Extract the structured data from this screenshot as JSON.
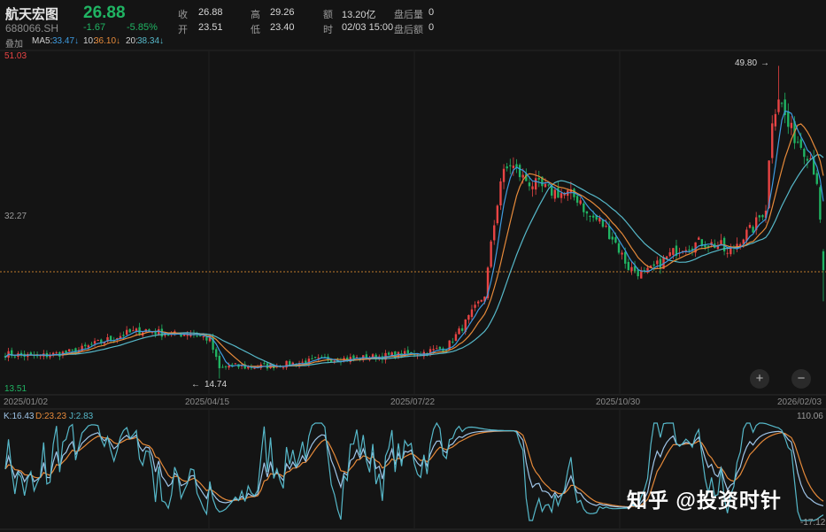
{
  "header": {
    "name": "航天宏图",
    "code": "688066.SH",
    "price": "26.88",
    "change": "-1.67",
    "change_pct": "-5.85%",
    "overlay_label": "叠加",
    "stats": [
      {
        "label": "收",
        "value": "26.88"
      },
      {
        "label": "开",
        "value": "23.51"
      },
      {
        "label": "高",
        "value": "29.26"
      },
      {
        "label": "低",
        "value": "23.40"
      },
      {
        "label": "额",
        "value": "13.20亿"
      },
      {
        "label": "时",
        "value": "02/03 15:00"
      },
      {
        "label": "盘后量",
        "value": "0"
      },
      {
        "label": "盘后额",
        "value": "0"
      }
    ],
    "ma": [
      {
        "label": "MA5:",
        "value": "33.47↓",
        "color": "#3d9be0"
      },
      {
        "label": "10:",
        "value": "36.10↓",
        "color": "#e68a3a"
      },
      {
        "label": "20:",
        "value": "38.34↓",
        "color": "#56b8c9"
      }
    ]
  },
  "price_axis": {
    "top": "51.03",
    "mid": "32.27",
    "bottom": "13.51"
  },
  "annotations": {
    "high": "49.80",
    "low": "14.74"
  },
  "dates": [
    "2025/01/02",
    "2025/04/15",
    "2025/07/22",
    "2025/10/30",
    "2026/02/03"
  ],
  "kdj": {
    "k": "K:16.43",
    "d": "D:23.23",
    "j": "J:2.83",
    "top": "110.06",
    "bottom": "-17.12",
    "colors": {
      "k": "#9fc5e8",
      "d": "#e68a3a",
      "j": "#56b8c9"
    }
  },
  "colors": {
    "up": "#e94444",
    "down": "#20b463",
    "ma5": "#3d9be0",
    "ma10": "#e68a3a",
    "ma20": "#56b8c9",
    "ref": "#c07a2c"
  },
  "controls": {
    "zoom_in": "+",
    "zoom_out": "−"
  },
  "watermark": "知乎 @投资时针",
  "chart_data": {
    "type": "candlestick",
    "x_start": "2025/01/02",
    "x_end": "2026/02/03",
    "ylim": [
      13.51,
      51.03
    ],
    "close_path": [
      [
        0,
        17.5
      ],
      [
        10,
        17.2
      ],
      [
        22,
        17.8
      ],
      [
        28,
        18.6
      ],
      [
        38,
        19.8
      ],
      [
        44,
        20.2
      ],
      [
        52,
        19.6
      ],
      [
        58,
        19.9
      ],
      [
        64,
        19.1
      ],
      [
        67,
        15.8
      ],
      [
        70,
        16.2
      ],
      [
        76,
        16.0
      ],
      [
        84,
        16.2
      ],
      [
        92,
        16.5
      ],
      [
        100,
        16.9
      ],
      [
        110,
        17.0
      ],
      [
        120,
        17.3
      ],
      [
        130,
        17.6
      ],
      [
        138,
        18.2
      ],
      [
        142,
        20.0
      ],
      [
        146,
        22.0
      ],
      [
        150,
        24.2
      ],
      [
        152,
        29.6
      ],
      [
        155,
        37.0
      ],
      [
        158,
        38.8
      ],
      [
        162,
        37.2
      ],
      [
        166,
        36.4
      ],
      [
        170,
        35.8
      ],
      [
        176,
        35.4
      ],
      [
        180,
        34.8
      ],
      [
        182,
        33.0
      ],
      [
        186,
        32.4
      ],
      [
        190,
        30.6
      ],
      [
        195,
        27.2
      ],
      [
        200,
        26.4
      ],
      [
        204,
        27.4
      ],
      [
        208,
        28.6
      ],
      [
        212,
        29.6
      ],
      [
        218,
        30.0
      ],
      [
        224,
        29.6
      ],
      [
        226,
        28.6
      ],
      [
        230,
        30.4
      ],
      [
        234,
        31.6
      ],
      [
        238,
        34.0
      ],
      [
        240,
        44.0
      ],
      [
        242,
        46.5
      ],
      [
        245,
        43.0
      ],
      [
        248,
        41.4
      ],
      [
        252,
        39.6
      ],
      [
        254,
        37.0
      ],
      [
        256,
        26.9
      ]
    ]
  }
}
